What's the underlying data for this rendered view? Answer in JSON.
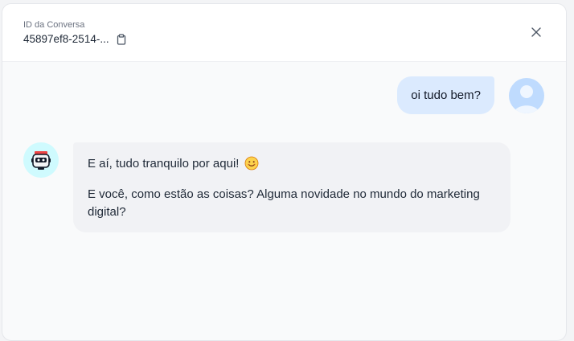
{
  "header": {
    "conversation_label": "ID da Conversa",
    "conversation_id": "45897ef8-2514-...",
    "copy_icon": "clipboard-icon",
    "close_icon": "close-icon"
  },
  "messages": {
    "user": {
      "text": "oi tudo bem?",
      "avatar_icon": "user-icon"
    },
    "bot": {
      "line1": "E aí, tudo tranquilo por aqui!",
      "line1_emoji": "smiling-face-icon",
      "line2": "E você, como estão as coisas? Alguma novidade no mundo do marketing digital?",
      "avatar_icon": "robot-icon"
    }
  },
  "colors": {
    "user_bubble": "#dbeafe",
    "bot_bubble": "#f1f2f5",
    "bot_avatar_bg": "#cffafe",
    "user_avatar_bg": "#bfdbfe"
  }
}
